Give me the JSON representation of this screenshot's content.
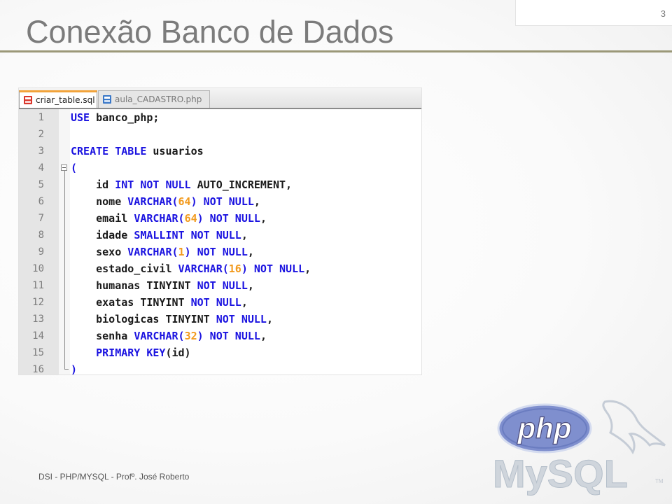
{
  "slide": {
    "number": "3",
    "title": "Conexão Banco de Dados",
    "footer": "DSI - PHP/MYSQL - Profº. José Roberto"
  },
  "editor": {
    "tabs": [
      {
        "label": "criar_table.sql",
        "active": true,
        "icon": "sql-file-icon"
      },
      {
        "label": "aula_CADASTRO.php",
        "active": false,
        "icon": "php-file-icon"
      }
    ],
    "lines": [
      {
        "n": "1",
        "tokens": [
          [
            "kw",
            "USE"
          ],
          [
            "txt",
            " banco_php;"
          ]
        ]
      },
      {
        "n": "2",
        "tokens": []
      },
      {
        "n": "3",
        "tokens": [
          [
            "kw",
            "CREATE TABLE"
          ],
          [
            "txt",
            " usuarios"
          ]
        ]
      },
      {
        "n": "4",
        "tokens": [
          [
            "op",
            "("
          ]
        ]
      },
      {
        "n": "5",
        "tokens": [
          [
            "txt",
            "    id "
          ],
          [
            "kw",
            "INT NOT NULL"
          ],
          [
            "txt",
            " AUTO_INCREMENT,"
          ]
        ]
      },
      {
        "n": "6",
        "tokens": [
          [
            "txt",
            "    nome "
          ],
          [
            "kw",
            "VARCHAR("
          ],
          [
            "num",
            "64"
          ],
          [
            "kw",
            ") NOT NULL"
          ],
          [
            "txt",
            ","
          ]
        ]
      },
      {
        "n": "7",
        "tokens": [
          [
            "txt",
            "    email "
          ],
          [
            "kw",
            "VARCHAR("
          ],
          [
            "num",
            "64"
          ],
          [
            "kw",
            ") NOT NULL"
          ],
          [
            "txt",
            ","
          ]
        ]
      },
      {
        "n": "8",
        "tokens": [
          [
            "txt",
            "    idade "
          ],
          [
            "kw",
            "SMALLINT NOT NULL"
          ],
          [
            "txt",
            ","
          ]
        ]
      },
      {
        "n": "9",
        "tokens": [
          [
            "txt",
            "    sexo "
          ],
          [
            "kw",
            "VARCHAR("
          ],
          [
            "num",
            "1"
          ],
          [
            "kw",
            ") NOT NULL"
          ],
          [
            "txt",
            ","
          ]
        ]
      },
      {
        "n": "10",
        "tokens": [
          [
            "txt",
            "    estado_civil "
          ],
          [
            "kw",
            "VARCHAR("
          ],
          [
            "num",
            "16"
          ],
          [
            "kw",
            ") NOT NULL"
          ],
          [
            "txt",
            ","
          ]
        ]
      },
      {
        "n": "11",
        "tokens": [
          [
            "txt",
            "    humanas TINYINT "
          ],
          [
            "kw",
            "NOT NULL"
          ],
          [
            "txt",
            ","
          ]
        ]
      },
      {
        "n": "12",
        "tokens": [
          [
            "txt",
            "    exatas TINYINT "
          ],
          [
            "kw",
            "NOT NULL"
          ],
          [
            "txt",
            ","
          ]
        ]
      },
      {
        "n": "13",
        "tokens": [
          [
            "txt",
            "    biologicas TINYINT "
          ],
          [
            "kw",
            "NOT NULL"
          ],
          [
            "txt",
            ","
          ]
        ]
      },
      {
        "n": "14",
        "tokens": [
          [
            "txt",
            "    senha "
          ],
          [
            "kw",
            "VARCHAR("
          ],
          [
            "num",
            "32"
          ],
          [
            "kw",
            ") NOT NULL"
          ],
          [
            "txt",
            ","
          ]
        ]
      },
      {
        "n": "15",
        "tokens": [
          [
            "txt",
            "    "
          ],
          [
            "kw",
            "PRIMARY KEY"
          ],
          [
            "txt",
            "(id)"
          ]
        ]
      },
      {
        "n": "16",
        "tokens": [
          [
            "op",
            ")"
          ]
        ]
      }
    ]
  },
  "logo": {
    "php_text": "php",
    "mysql_text": "MySQL",
    "tm": "TM"
  },
  "colors": {
    "keyword": "#1a12e0",
    "number": "#f29a1d",
    "title_rule": "#9b9878",
    "active_tab_accent": "#f2a33a"
  }
}
